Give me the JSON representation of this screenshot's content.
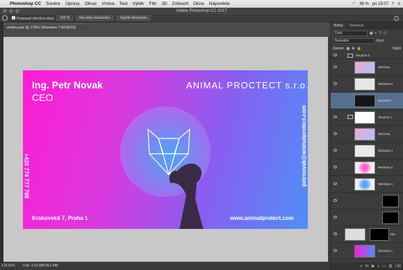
{
  "menubar": {
    "app": "Photoshop CC",
    "items": [
      "Soubor",
      "Úpravy",
      "Obraz",
      "Vrstva",
      "Text",
      "Výběr",
      "Filtr",
      "3D",
      "Zobrazit",
      "Okna",
      "Nápověda"
    ],
    "battery": "36 %",
    "clock": "po 15:07"
  },
  "window": {
    "title": "Adobe Photoshop CC 2017"
  },
  "options": {
    "scroll_all": "Posouvat všechna okna",
    "zoom": "100 %",
    "fit_screen": "Na celou obrazovku",
    "fill_screen": "Vyplnit obrazovku"
  },
  "document": {
    "tab": "vizitka.psd @ 178% (Warstwa 7,RGB/16)"
  },
  "card": {
    "name": "Ing. Petr Novak",
    "role": "CEO",
    "brand": "ANIMAL PROCTECT s.r.o.",
    "phone": "+420 774 777 789",
    "email": "petrnovak@animalprotect.com",
    "address": "Krakovská 7, Praha 1",
    "web": "www.animalprotect.com"
  },
  "status": {
    "zoom": "178,41%",
    "doc": "Dok: 3,59 MB/28,0 MB"
  },
  "panel": {
    "tabs": [
      "Vrstvy",
      "Vlastnosti"
    ],
    "filter": "Druh",
    "blend": "Normální",
    "opacity_label": "Krytí",
    "lock_label": "Zámek:",
    "fill_label": "Výplň",
    "layers": [
      {
        "name": "Skupina 2",
        "type": "group"
      },
      {
        "name": "Warstwa",
        "type": "layer"
      },
      {
        "name": "Warstwa 8",
        "type": "layer"
      },
      {
        "name": "Warstwa 7",
        "type": "layer",
        "selected": true
      },
      {
        "name": "Skupina 1",
        "type": "group"
      },
      {
        "name": "Warstwa",
        "type": "layer"
      },
      {
        "name": "Warstwa 3",
        "type": "layer"
      },
      {
        "name": "Warstwa 5",
        "type": "layer"
      },
      {
        "name": "Warstwa 4",
        "type": "layer"
      },
      {
        "name": "",
        "type": "adjust"
      },
      {
        "name": "",
        "type": "adjust"
      },
      {
        "name": "Wa",
        "type": "layer"
      },
      {
        "name": "Warstwa 1",
        "type": "layer"
      }
    ]
  },
  "colors": {
    "accent": "#57708f",
    "pink": "#ff1cd3",
    "blue": "#4f8ff7"
  }
}
